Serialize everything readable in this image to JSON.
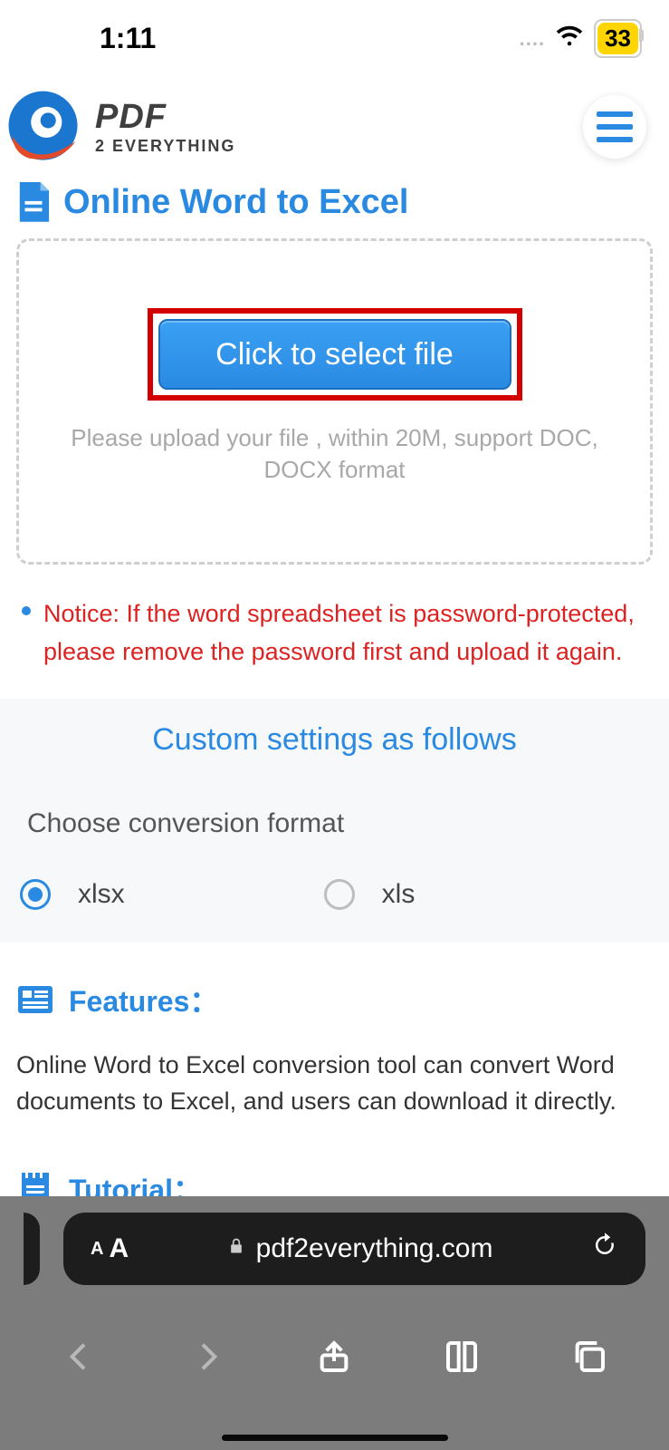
{
  "status": {
    "time": "1:11",
    "dots": "....",
    "battery": "33"
  },
  "header": {
    "logo_line1": "PDF",
    "logo_line2": "2 EVERYTHING"
  },
  "page": {
    "title": "Online Word to Excel"
  },
  "upload": {
    "button_label": "Click to select file",
    "hint": "Please upload your file , within 20M, support DOC, DOCX format"
  },
  "notice": {
    "text": "Notice: If the word spreadsheet is password-protected, please remove the password first and upload it again."
  },
  "settings": {
    "title": "Custom settings as follows",
    "format_label": "Choose conversion format",
    "options": [
      {
        "label": "xlsx",
        "selected": true
      },
      {
        "label": "xls",
        "selected": false
      }
    ]
  },
  "features": {
    "heading": "Features：",
    "body": "Online Word to Excel conversion tool can convert Word documents to Excel, and users can download it directly."
  },
  "tutorial": {
    "heading": "Tutorial："
  },
  "browser": {
    "aa": "AA",
    "domain": "pdf2everything.com"
  }
}
